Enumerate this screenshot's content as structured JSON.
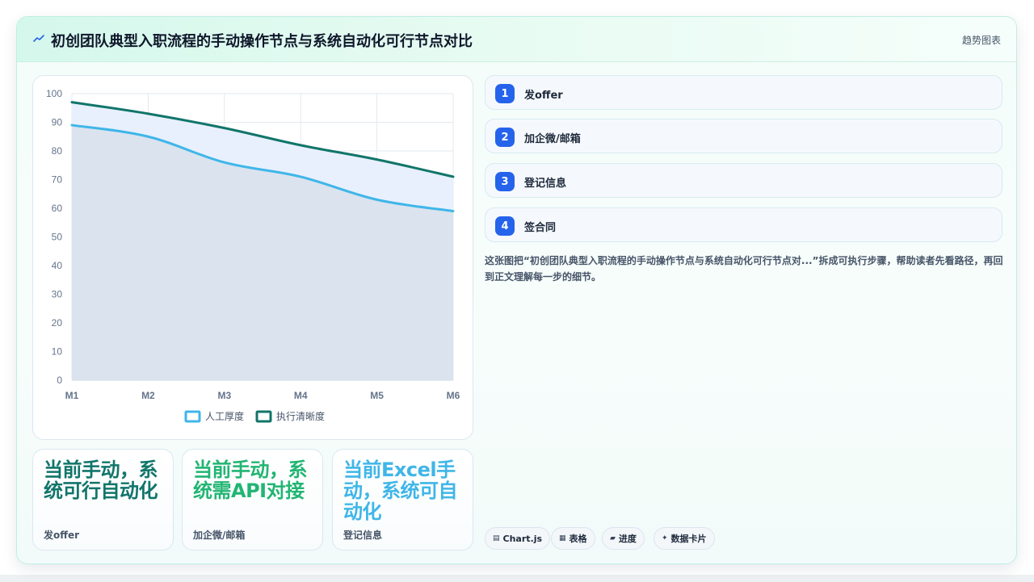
{
  "header": {
    "title": "初创团队典型入职流程的手动操作节点与系统自动化可行节点对比",
    "tag": "趋势图表"
  },
  "chart_data": {
    "type": "line",
    "categories": [
      "M1",
      "M2",
      "M3",
      "M4",
      "M5",
      "M6"
    ],
    "series": [
      {
        "name": "人工厚度",
        "values": [
          89,
          85,
          76,
          71,
          63,
          59
        ],
        "color": "#3fb6e8",
        "fill": "#dbe3ef"
      },
      {
        "name": "执行清晰度",
        "values": [
          97,
          93,
          88,
          82,
          77,
          71
        ],
        "color": "#11756a",
        "fill": "#e8f0fd"
      }
    ],
    "ylim": [
      0,
      100
    ],
    "yticks": [
      0,
      10,
      20,
      30,
      40,
      50,
      60,
      70,
      80,
      90,
      100
    ],
    "grid": true,
    "legend": "bottom",
    "title": "",
    "xlabel": "",
    "ylabel": ""
  },
  "stats": [
    {
      "value": "当前手动，系统可行自动化",
      "label": "发offer",
      "color": "#11756a"
    },
    {
      "value": "当前手动，系统需API对接",
      "label": "加企微/邮箱",
      "color": "#22b573"
    },
    {
      "value": "当前Excel手动，系统可自动化",
      "label": "登记信息",
      "color": "#3fb6e8"
    }
  ],
  "steps": [
    {
      "num": "1",
      "label": "发offer"
    },
    {
      "num": "2",
      "label": "加企微/邮箱"
    },
    {
      "num": "3",
      "label": "登记信息"
    },
    {
      "num": "4",
      "label": "签合同"
    }
  ],
  "description": "这张图把“初创团队典型入职流程的手动操作节点与系统自动化可行节点对...”拆成可执行步骤，帮助读者先看路径，再回到正文理解每一步的细节。",
  "chips": [
    {
      "icon": "▤",
      "label": "Chart.js"
    },
    {
      "icon": "▦",
      "label": "表格"
    },
    {
      "icon": "▰",
      "label": "进度"
    },
    {
      "icon": "✦",
      "label": "数据卡片"
    }
  ]
}
